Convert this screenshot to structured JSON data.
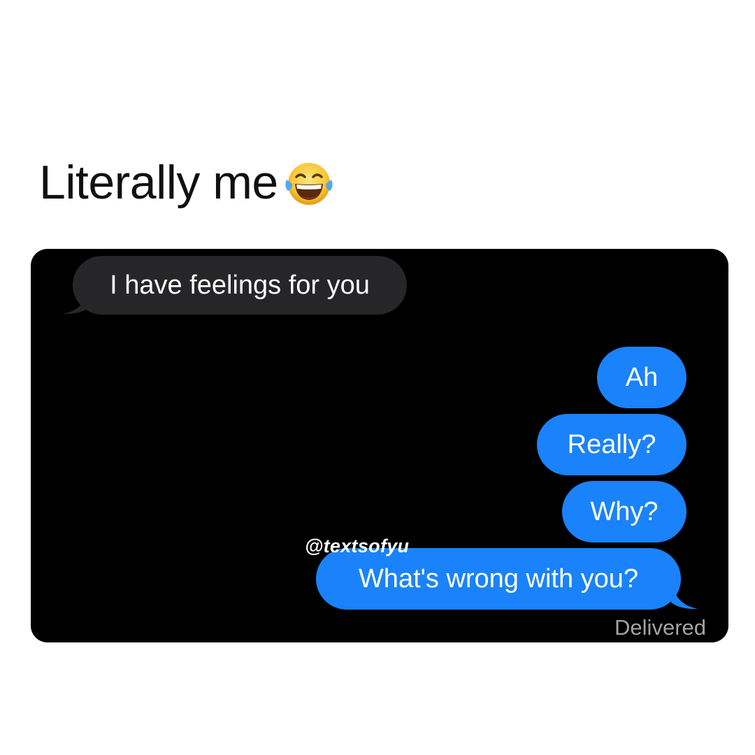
{
  "caption": {
    "text": "Literally me",
    "emoji": "face-with-tears-of-joy"
  },
  "conversation": {
    "incoming": [
      {
        "text": "I have feelings for you"
      }
    ],
    "outgoing": [
      {
        "text": "Ah"
      },
      {
        "text": "Really?"
      },
      {
        "text": "Why?"
      },
      {
        "text": "What's wrong with you?"
      }
    ],
    "status": "Delivered"
  },
  "watermark": "@textsofyu",
  "colors": {
    "chat_background": "#000000",
    "incoming_bubble": "#262628",
    "outgoing_bubble": "#1a82fb",
    "status_text": "#a3a3a8"
  }
}
